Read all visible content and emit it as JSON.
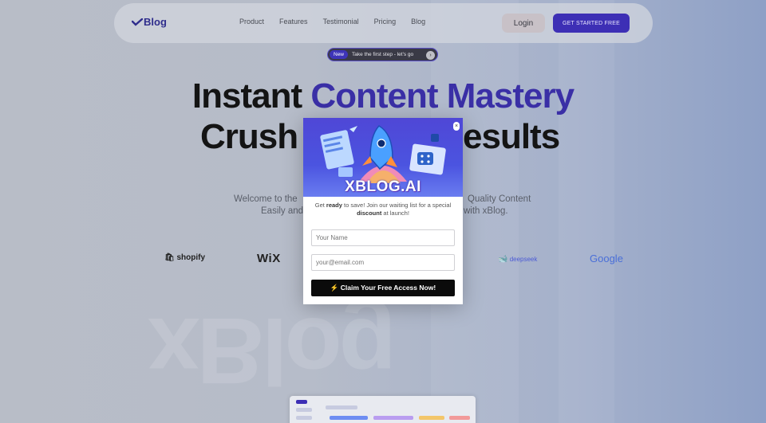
{
  "brand": {
    "logo_text": "Blog"
  },
  "nav": {
    "links": [
      "Product",
      "Features",
      "Testimonial",
      "Pricing",
      "Blog"
    ],
    "login_label": "Login",
    "cta_label": "GET STARTED FREE"
  },
  "announcement": {
    "tag": "New",
    "text": "Take the first step - let's go",
    "arrow": "›"
  },
  "hero": {
    "line1_plain": "Instant ",
    "line1_accent": "Content Mastery",
    "line2_left": "Crush",
    "line2_right": "esults",
    "sub_left_1": "Welcome to the",
    "sub_right_1": "Quality Content",
    "sub_left_2": "Easily and",
    "sub_right_2": "with xBlog."
  },
  "partners": {
    "shopify": "shopify",
    "wix": "WiX",
    "deepseek": "deepseek",
    "google": "Google"
  },
  "watermark": "xBlog",
  "modal": {
    "close": "×",
    "banner_title": "XBLOG.AI",
    "text_1": "Get ",
    "text_bold_1": "ready",
    "text_2": " to save! Join our waiting list for a special ",
    "text_bold_2": "discount",
    "text_3": " at launch!",
    "name_placeholder": "Your Name",
    "email_placeholder": "your@email.com",
    "claim_label": "⚡ Claim Your Free Access Now!"
  },
  "colors": {
    "accent": "#3a2fa6",
    "cta": "#3d2fb5",
    "button_dark": "#0b0b0b"
  }
}
